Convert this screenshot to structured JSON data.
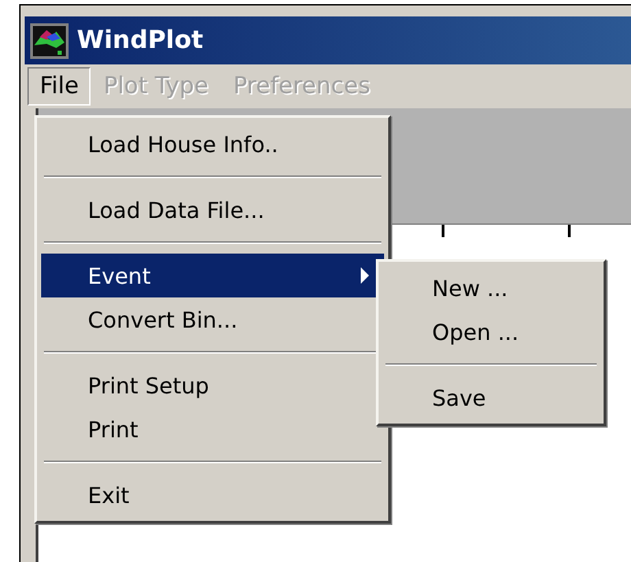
{
  "window": {
    "title": "WindPlot"
  },
  "menu_bar": [
    {
      "label": "File",
      "selected": true,
      "disabled": false
    },
    {
      "label": "Plot Type",
      "selected": false,
      "disabled": true
    },
    {
      "label": "Preferences",
      "selected": false,
      "disabled": true
    }
  ],
  "file_menu": [
    {
      "kind": "item",
      "label": "Load House Info..",
      "selected": false,
      "submenu": false
    },
    {
      "kind": "separator"
    },
    {
      "kind": "item",
      "label": "Load Data File...",
      "selected": false,
      "submenu": false
    },
    {
      "kind": "separator"
    },
    {
      "kind": "item",
      "label": "Event",
      "selected": true,
      "submenu": true
    },
    {
      "kind": "item",
      "label": "Convert Bin...",
      "selected": false,
      "submenu": false
    },
    {
      "kind": "separator"
    },
    {
      "kind": "item",
      "label": "Print Setup",
      "selected": false,
      "submenu": false
    },
    {
      "kind": "item",
      "label": "Print",
      "selected": false,
      "submenu": false
    },
    {
      "kind": "separator"
    },
    {
      "kind": "item",
      "label": "Exit",
      "selected": false,
      "submenu": false
    }
  ],
  "event_submenu": [
    {
      "kind": "item",
      "label": "New ...",
      "selected": false
    },
    {
      "kind": "item",
      "label": "Open ...",
      "selected": false
    },
    {
      "kind": "separator"
    },
    {
      "kind": "item",
      "label": "Save",
      "selected": false
    }
  ]
}
